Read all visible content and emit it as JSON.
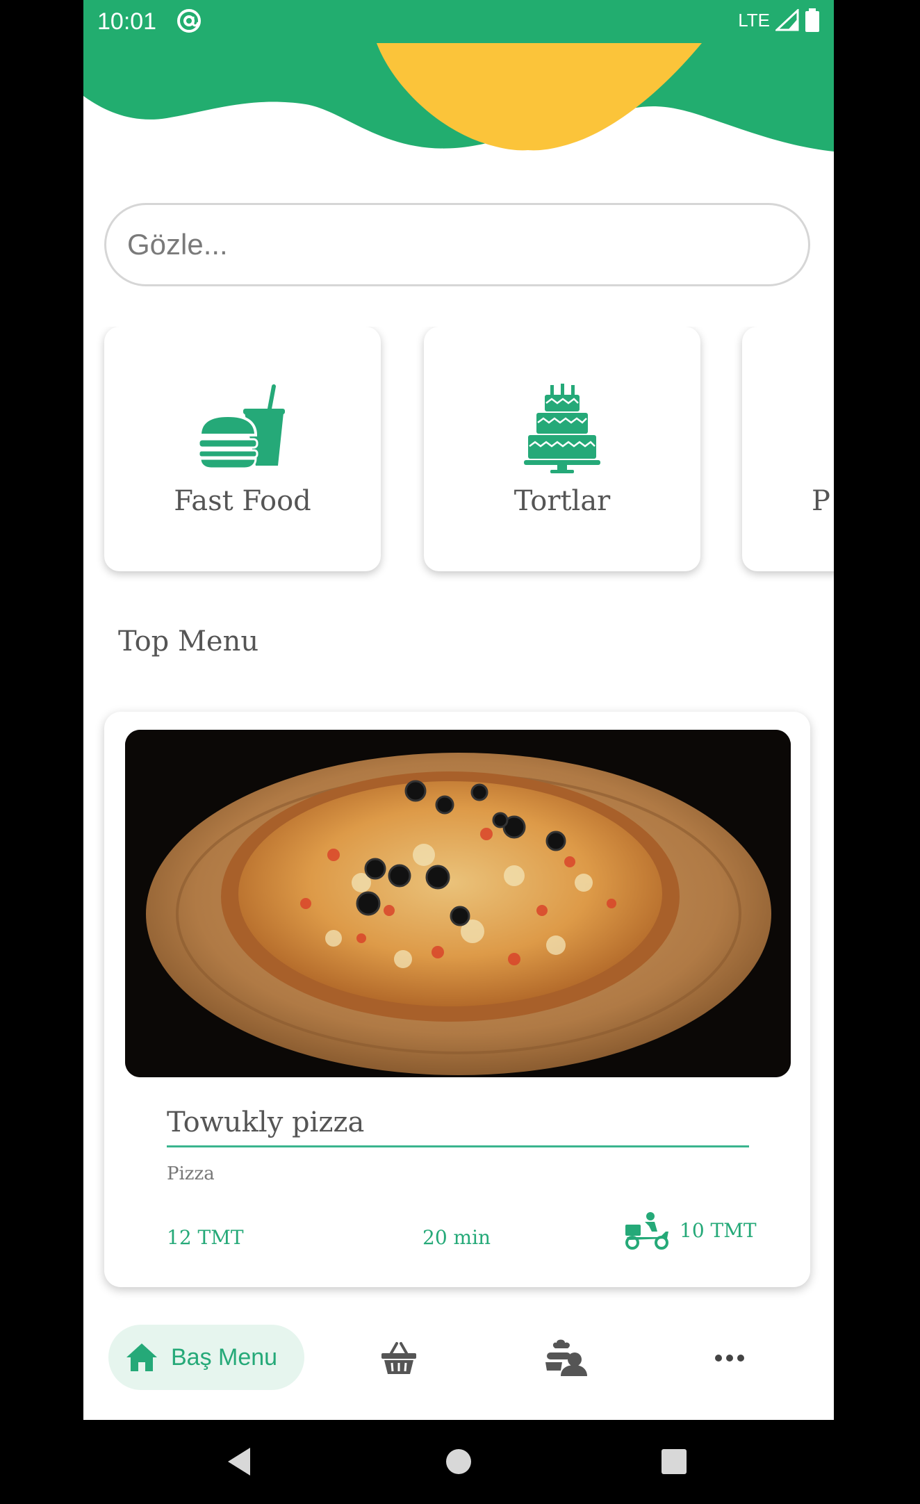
{
  "status_bar": {
    "time": "10:01",
    "network": "LTE"
  },
  "search": {
    "placeholder": "Gözle..."
  },
  "categories": [
    {
      "label": "Fast Food",
      "icon": "fast-food-icon"
    },
    {
      "label": "Tortlar",
      "icon": "cake-icon"
    },
    {
      "label": "P",
      "icon": "pizza-icon"
    }
  ],
  "section_title": "Top Menu",
  "menu_item": {
    "name": "Towukly pizza",
    "category": "Pizza",
    "price": "12 TMT",
    "time": "20 min",
    "delivery_price": "10 TMT",
    "image": "pizza-photo"
  },
  "bottom_nav": {
    "home_label": "Baş Menu",
    "items": [
      "home-icon",
      "basket-icon",
      "chef-icon",
      "more-icon"
    ]
  },
  "colors": {
    "brand_green": "#25a978",
    "header_green": "#22ad6f",
    "header_yellow": "#fbc43a",
    "accent_underline": "#3ab48e"
  }
}
